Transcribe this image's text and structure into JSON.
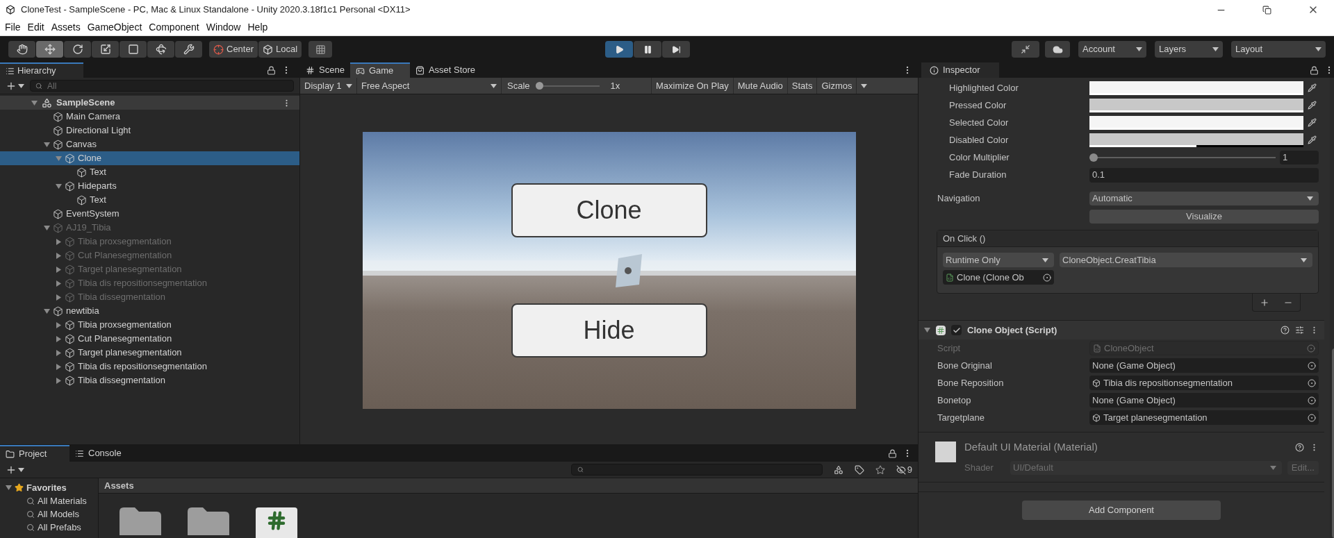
{
  "window": {
    "title": "CloneTest - SampleScene - PC, Mac & Linux Standalone - Unity 2020.3.18f1c1 Personal <DX11>"
  },
  "menu": [
    "File",
    "Edit",
    "Assets",
    "GameObject",
    "Component",
    "Window",
    "Help"
  ],
  "toolbar": {
    "tools": [
      {
        "kind": "hand",
        "selected": false
      },
      {
        "kind": "move",
        "selected": true
      },
      {
        "kind": "rotate",
        "selected": false
      },
      {
        "kind": "scale",
        "selected": false
      },
      {
        "kind": "rect",
        "selected": false
      },
      {
        "kind": "transform",
        "selected": false
      },
      {
        "kind": "custom",
        "selected": false
      }
    ],
    "handles": [
      {
        "kind": "pivot",
        "label": "Center"
      },
      {
        "kind": "space",
        "label": "Local"
      }
    ],
    "playback": [
      {
        "kind": "play",
        "selected": true
      },
      {
        "kind": "pause",
        "selected": false
      },
      {
        "kind": "step",
        "selected": false
      }
    ],
    "account": "Account",
    "layers": "Layers",
    "layout": "Layout"
  },
  "hierarchy": {
    "tab": "Hierarchy",
    "search": {
      "placeholder": "All"
    },
    "scene": "SampleScene",
    "items": [
      {
        "name": "Main Camera",
        "active": true,
        "selected": false
      },
      {
        "name": "Directional Light",
        "active": true,
        "selected": false
      },
      {
        "name": "Canvas",
        "active": true,
        "selected": false,
        "expanded": true,
        "children": [
          {
            "name": "Clone",
            "active": true,
            "selected": true,
            "expanded": true,
            "children": [
              {
                "name": "Text",
                "active": true,
                "selected": false
              }
            ]
          },
          {
            "name": "Hideparts",
            "active": true,
            "selected": false,
            "expanded": true,
            "children": [
              {
                "name": "Text",
                "active": true,
                "selected": false
              }
            ]
          }
        ]
      },
      {
        "name": "EventSystem",
        "active": true,
        "selected": false
      },
      {
        "name": "AJ19_Tibia",
        "active": false,
        "selected": false,
        "expanded": true,
        "children": [
          {
            "name": "Tibia proxsegmentation",
            "active": false,
            "selected": false,
            "expanded": false
          },
          {
            "name": "Cut Planesegmentation",
            "active": false,
            "selected": false,
            "expanded": false
          },
          {
            "name": "Target planesegmentation",
            "active": false,
            "selected": false,
            "expanded": false
          },
          {
            "name": "Tibia dis repositionsegmentation",
            "active": false,
            "selected": false,
            "expanded": false
          },
          {
            "name": "Tibia dissegmentation",
            "active": false,
            "selected": false,
            "expanded": false
          }
        ]
      },
      {
        "name": "newtibia",
        "active": true,
        "selected": false,
        "expanded": true,
        "children": [
          {
            "name": "Tibia proxsegmentation",
            "active": true,
            "selected": false,
            "expanded": false
          },
          {
            "name": "Cut Planesegmentation",
            "active": true,
            "selected": false,
            "expanded": false
          },
          {
            "name": "Target planesegmentation",
            "active": true,
            "selected": false,
            "expanded": false
          },
          {
            "name": "Tibia dis repositionsegmentation",
            "active": true,
            "selected": false,
            "expanded": false
          },
          {
            "name": "Tibia dissegmentation",
            "active": true,
            "selected": false,
            "expanded": false
          }
        ]
      }
    ]
  },
  "game": {
    "tabs": [
      {
        "kind": "scene",
        "label": "Scene",
        "selected": false
      },
      {
        "kind": "game",
        "label": "Game",
        "selected": true
      },
      {
        "kind": "store",
        "label": "Asset Store",
        "selected": false
      }
    ],
    "display": "Display 1",
    "aspect": "Free Aspect",
    "scale": {
      "label": "Scale",
      "level": 0,
      "reading": "1x"
    },
    "toggles": [
      "Maximize On Play",
      "Mute Audio",
      "Stats",
      "Gizmos"
    ],
    "ui_buttons": [
      "Clone",
      "Hide"
    ]
  },
  "inspector": {
    "tab": "Inspector",
    "color_rows": [
      {
        "label": "Highlighted Color",
        "color": "#f5f5f5",
        "level": 1
      },
      {
        "label": "Pressed Color",
        "color": "#c8c8c8",
        "level": 1
      },
      {
        "label": "Selected Color",
        "color": "#f5f5f5",
        "level": 1
      },
      {
        "label": "Disabled Color",
        "color": "#c8c8c8",
        "level": 0.5
      }
    ],
    "multiplier": {
      "label": "Color Multiplier",
      "level": 0,
      "reading": "1"
    },
    "fade": {
      "label": "Fade Duration",
      "value": "0.1"
    },
    "navigation": {
      "label": "Navigation",
      "value": "Automatic",
      "button": "Visualize"
    },
    "on_click": {
      "title": "On Click ()",
      "mode": "Runtime Only",
      "function": "CloneObject.CreatTibia",
      "target": "Clone (Clone Ob"
    },
    "component": {
      "title": "Clone Object (Script)",
      "enabled": true,
      "fields": [
        {
          "label": "Script",
          "value": "CloneObject",
          "kind": "script",
          "disabled": true
        },
        {
          "label": "Bone Original",
          "value": "None (Game Object)",
          "kind": "none",
          "disabled": false
        },
        {
          "label": "Bone Reposition",
          "value": "Tibia dis repositionsegmentation",
          "kind": "object",
          "disabled": false
        },
        {
          "label": "Bonetop",
          "value": "None (Game Object)",
          "kind": "none",
          "disabled": false
        },
        {
          "label": "Targetplane",
          "value": "Target planesegmentation",
          "kind": "object",
          "disabled": false
        }
      ]
    },
    "material": {
      "title": "Default UI Material (Material)",
      "shader_label": "Shader",
      "shader": "UI/Default",
      "edit": "Edit..."
    },
    "add_component": "Add Component"
  },
  "project": {
    "tabs": [
      {
        "kind": "project",
        "label": "Project",
        "selected": true
      },
      {
        "kind": "console",
        "label": "Console",
        "selected": false
      }
    ],
    "favorites": {
      "label": "Favorites",
      "expanded": true,
      "items": [
        "All Materials",
        "All Models",
        "All Prefabs"
      ]
    },
    "assets_header": "Assets",
    "assets": [
      {
        "kind": "folder"
      },
      {
        "kind": "folder"
      },
      {
        "kind": "script"
      }
    ],
    "hidden_count": "9"
  }
}
